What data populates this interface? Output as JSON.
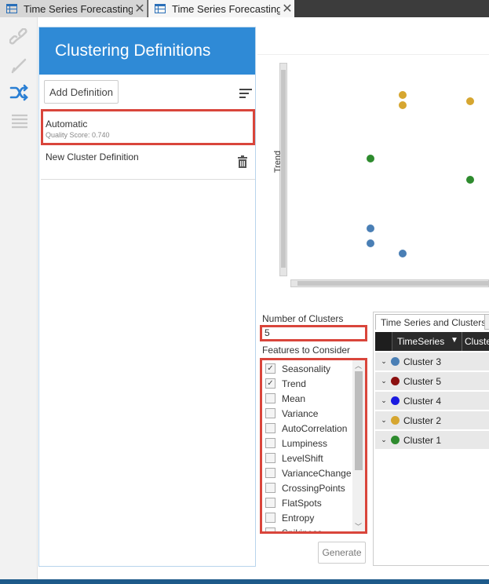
{
  "tabs": [
    {
      "label": "Time Series Forecasting...",
      "close": "✕"
    },
    {
      "label": "Time Series Forecasting...",
      "close": "✕"
    }
  ],
  "rail": {
    "icons": [
      "link-icon",
      "pencil-icon",
      "shuffle-icon",
      "list-icon"
    ]
  },
  "definitions": {
    "title": "Clustering Definitions",
    "add_label": "Add Definition",
    "items": [
      {
        "title": "Automatic",
        "subtitle": "Quality Score: 0.740"
      },
      {
        "title": "New Cluster Definition"
      }
    ]
  },
  "chart_data": {
    "type": "scatter",
    "ylabel": "Trend",
    "points": [
      {
        "col": 1,
        "y": 8.5,
        "color": "#d6a630"
      },
      {
        "col": 1,
        "y": 8.0,
        "color": "#d6a630"
      },
      {
        "col": 2,
        "y": 8.2,
        "color": "#d6a630"
      },
      {
        "col": 0,
        "y": 5.5,
        "color": "#2e8b2e"
      },
      {
        "col": 2,
        "y": 4.5,
        "color": "#2e8b2e"
      },
      {
        "col": 0,
        "y": 2.2,
        "color": "#4a7fb5"
      },
      {
        "col": 0,
        "y": 1.5,
        "color": "#4a7fb5"
      },
      {
        "col": 1,
        "y": 1.0,
        "color": "#4a7fb5"
      }
    ]
  },
  "controls": {
    "num_clusters_label": "Number of Clusters",
    "num_clusters_value": "5",
    "features_label": "Features to Consider",
    "features": [
      {
        "name": "Seasonality",
        "checked": true
      },
      {
        "name": "Trend",
        "checked": true
      },
      {
        "name": "Mean",
        "checked": false
      },
      {
        "name": "Variance",
        "checked": false
      },
      {
        "name": "AutoCorrelation",
        "checked": false
      },
      {
        "name": "Lumpiness",
        "checked": false
      },
      {
        "name": "LevelShift",
        "checked": false
      },
      {
        "name": "VarianceChange",
        "checked": false
      },
      {
        "name": "CrossingPoints",
        "checked": false
      },
      {
        "name": "FlatSpots",
        "checked": false
      },
      {
        "name": "Entropy",
        "checked": false
      },
      {
        "name": "Spikiness",
        "checked": false
      }
    ],
    "generate_label": "Generate"
  },
  "clusters_panel": {
    "tab_label": "Time Series and Clusters",
    "col1": "TimeSeries",
    "col2": "Cluste",
    "rows": [
      {
        "label": "Cluster 3",
        "color": "#4a7fb5"
      },
      {
        "label": "Cluster 5",
        "color": "#8b1010"
      },
      {
        "label": "Cluster 4",
        "color": "#1a1ae0"
      },
      {
        "label": "Cluster 2",
        "color": "#d6a630"
      },
      {
        "label": "Cluster 1",
        "color": "#2e8b2e"
      }
    ]
  }
}
